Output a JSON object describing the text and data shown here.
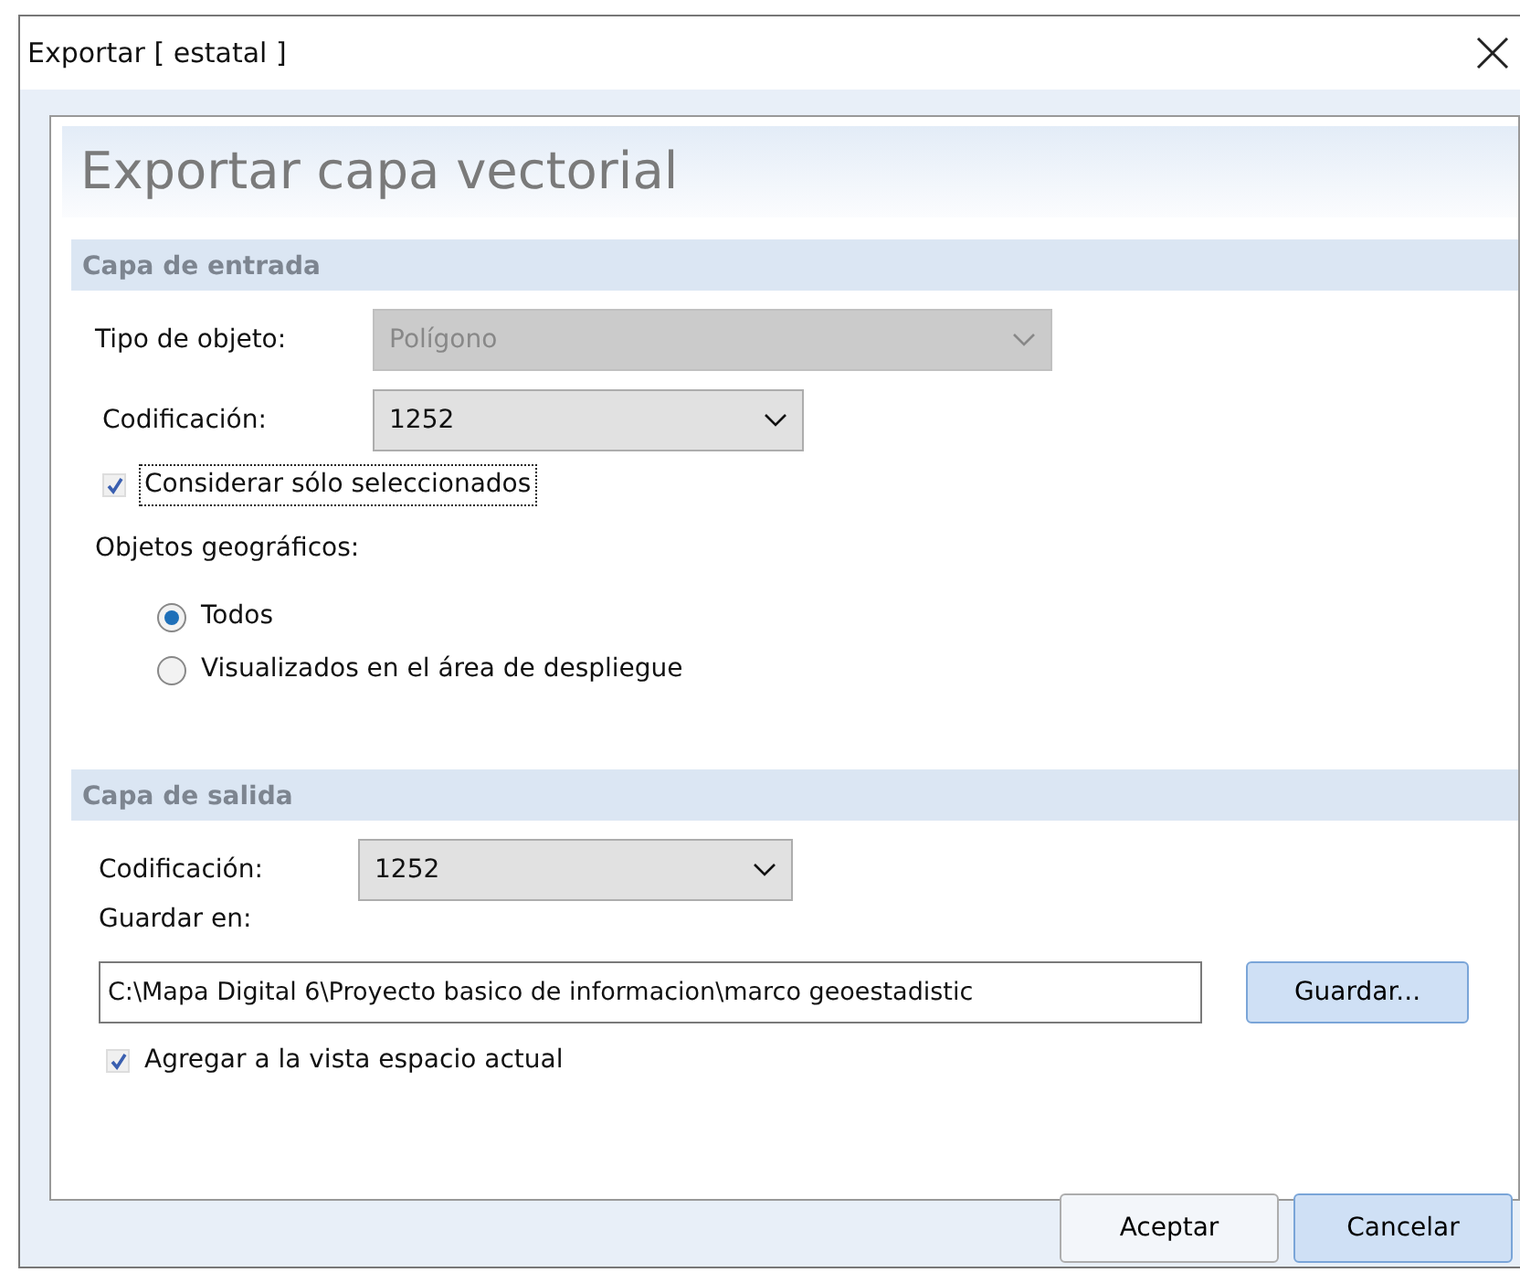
{
  "window": {
    "title": "Exportar [ estatal ]"
  },
  "heading": "Exportar capa vectorial",
  "input_layer": {
    "title": "Capa de entrada",
    "object_type": {
      "label": "Tipo de objeto:",
      "value": "Polígono",
      "disabled": true
    },
    "encoding": {
      "label": "Codificación:",
      "value": "1252",
      "disabled": false
    },
    "only_selected": {
      "label": "Considerar sólo seleccionados",
      "checked": true,
      "focused": true
    },
    "features_label": "Objetos geográficos:",
    "options": [
      {
        "label": "Todos",
        "selected": true
      },
      {
        "label": "Visualizados en el área de despliegue",
        "selected": false
      }
    ]
  },
  "output_layer": {
    "title": "Capa de salida",
    "encoding": {
      "label": "Codificación:",
      "value": "1252",
      "disabled": false
    },
    "save_label": "Guardar en:",
    "path": "C:\\Mapa Digital 6\\Proyecto basico de informacion\\marco geoestadistic",
    "save_button": "Guardar...",
    "add_to_view": {
      "label": "Agregar a la vista espacio actual",
      "checked": true,
      "focused": false
    }
  },
  "buttons": [
    {
      "label": "Aceptar",
      "default": false
    },
    {
      "label": "Cancelar",
      "default": true
    }
  ]
}
